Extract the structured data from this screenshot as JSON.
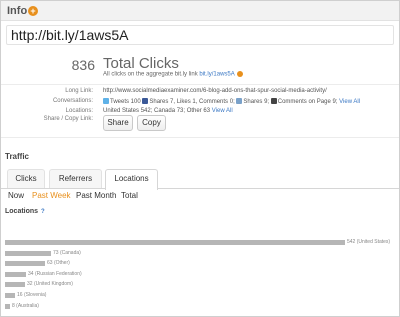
{
  "info": {
    "title": "Info",
    "add_icon": "plus-circle-icon",
    "accent": "#e8901d"
  },
  "short_url": "http://bit.ly/1aws5A",
  "clicks": {
    "total": "836",
    "label": "Total Clicks",
    "sub_text": "All clicks on the aggregate bit.ly link",
    "sub_link": "bit.ly/1aws5A"
  },
  "details": {
    "long_link_label": "Long Link:",
    "long_link": "http://www.socialmediaexaminer.com/6-blog-add-ons-that-spur-social-media-activity/",
    "conversations_label": "Conversations:",
    "tweets": "Tweets 100",
    "facebook": "Shares 7, Likes 1, Comments 0;",
    "linkedin": "Shares 9;",
    "page_comments": "Comments on Page 9;",
    "view_all": "View All",
    "locations_label": "Locations:",
    "locations_text": "United States 542; Canada 73; Other 63",
    "locations_view_all": "View All",
    "share_label": "Share / Copy Link:",
    "share_button": "Share",
    "copy_button": "Copy"
  },
  "traffic": {
    "title": "Traffic",
    "tabs": [
      "Clicks",
      "Referrers",
      "Locations"
    ],
    "active_tab": "Locations",
    "periods": [
      "Now",
      "Past Week",
      "Past Month",
      "Total"
    ],
    "active_period": "Past Week",
    "bar_color": "#b6b6b6"
  },
  "locations": {
    "title": "Locations",
    "help": "?"
  },
  "chart_data": {
    "type": "bar",
    "categories": [
      "United States",
      "Canada",
      "Other",
      "Russian Federation",
      "United Kingdom",
      "Slovenia",
      "Australia"
    ],
    "values": [
      542,
      73,
      63,
      34,
      32,
      16,
      8
    ],
    "labels": [
      "542 (United States)",
      "73 (Canada)",
      "63 (Other)",
      "34 (Russian Federation)",
      "32 (United Kingdom)",
      "16 (Slovenia)",
      "8 (Australia)"
    ]
  }
}
